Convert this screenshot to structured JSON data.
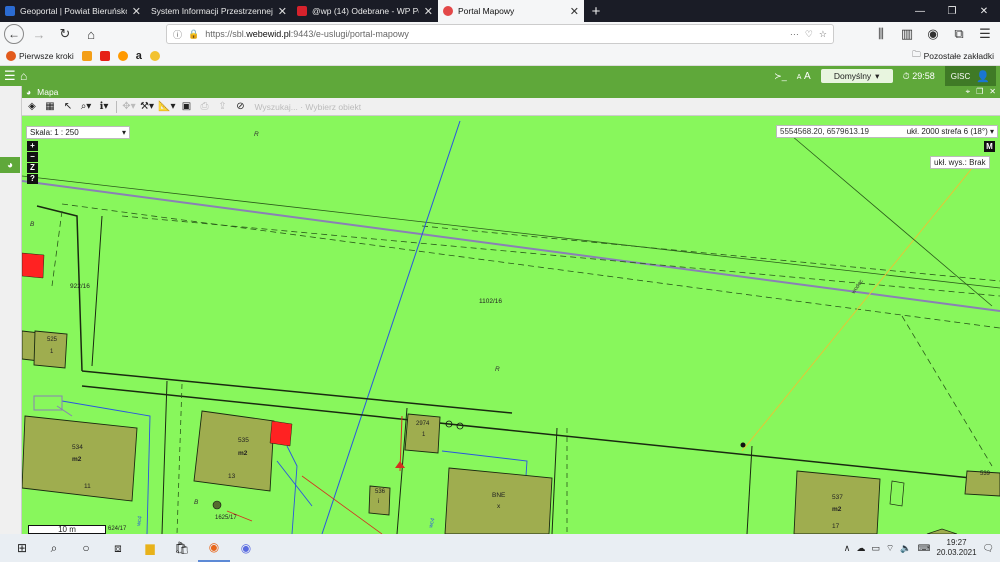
{
  "browser": {
    "tabs": [
      {
        "title": "Geoportal | Powiat Bieruńsko-L",
        "favicon_color": "#2b6bd1"
      },
      {
        "title": "System Informacji Przestrzennej Po",
        "favicon_color": "#1a1c26"
      },
      {
        "title": "@wp (14) Odebrane - WP Poczt",
        "favicon_color": "#d6222c"
      },
      {
        "title": "Portal Mapowy",
        "favicon_color": "#e34848"
      }
    ],
    "active_tab": 3,
    "url_prefix": "https://sbl.",
    "url_host": "webewid.pl",
    "url_rest": ":9443/e-uslugi/portal-mapowy",
    "url_menu": "···",
    "bookmarks": [
      {
        "label": "Pierwsze kroki",
        "color": "#e25a1c"
      },
      {
        "label": "",
        "color": "#f49f18"
      },
      {
        "label": "",
        "color": "#e62117"
      },
      {
        "label": "",
        "color": "#ff9900"
      },
      {
        "label": "a",
        "color": "#ffffff"
      },
      {
        "label": "",
        "color": "#f2c230"
      }
    ],
    "other_bookmarks": "Pozostałe zakładki"
  },
  "app": {
    "profile_label": "Domyślny",
    "timer": "29:58",
    "font_a_small": "A",
    "font_a_large": "A",
    "user_label": "GISC",
    "panel_title": "Mapa",
    "toolbar_text": "Wyszukaj... · Wybierz obiekt",
    "colors": {
      "header": "#5fa83a",
      "map_bg": "#88f75c",
      "parcel_fill": "#9fad4f",
      "highlight": "#ff2222"
    }
  },
  "map": {
    "scale_label": "Skala:",
    "scale_value": "1 : 250",
    "coordinates": "5554568.20, 6579613.19",
    "crs": "ukł. 2000 strefa 6 (18°)",
    "height_system": "ukł. wys.: Brak",
    "m_badge": "M",
    "scalebar": "10 m",
    "zoom_buttons": [
      "+",
      "−",
      "Z",
      "?"
    ],
    "labels": {
      "p922": "922/16",
      "p1102": "1102/16",
      "p525": "525",
      "p525n": "1",
      "p534": "534",
      "p534m": "m2",
      "p534n": "11",
      "p535": "535",
      "p535m": "m2",
      "p535n": "13",
      "p2974": "2974",
      "p2974n": "1",
      "p536": "536",
      "p536n": "i",
      "pbne": "BNE",
      "pbnex": "x",
      "p537": "537",
      "p537m": "m2",
      "p537n": "17",
      "p539": "539",
      "p1625": "1625/17",
      "p624": "624/17",
      "R1": "R",
      "R2": "R",
      "B1": "B",
      "B2": "B",
      "wodoc": "wodoc",
      "wc1": "wc4",
      "wc2": "wc4"
    }
  },
  "taskbar": {
    "time": "19:27",
    "date": "20.03.2021"
  }
}
